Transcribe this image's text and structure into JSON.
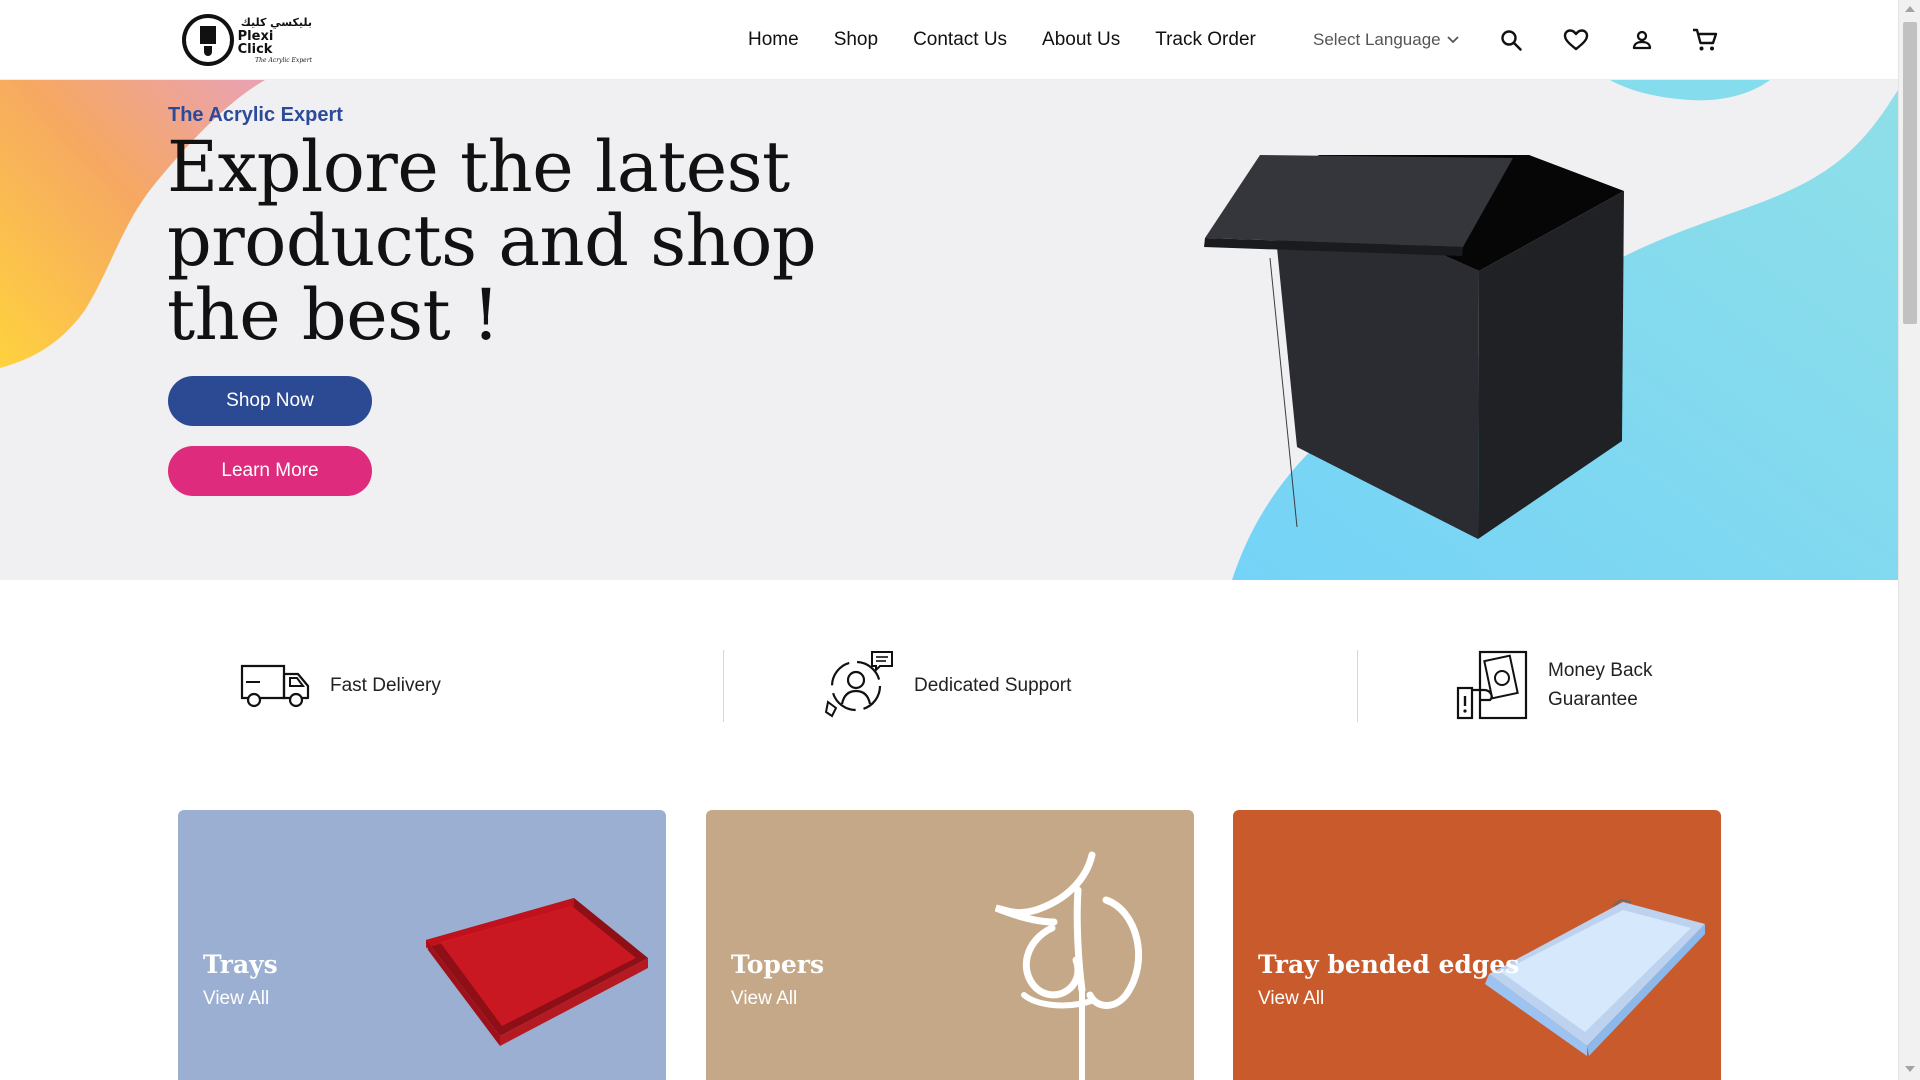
{
  "brand": {
    "arabic_name": "بليكسي كليك",
    "name": "Plexi Click",
    "tagline": "The Acrylic Expert"
  },
  "nav": {
    "items": [
      "Home",
      "Shop",
      "Contact Us",
      "About Us",
      "Track Order"
    ]
  },
  "language": {
    "label": "Select Language"
  },
  "header_icons": [
    "search-icon",
    "heart-icon",
    "user-icon",
    "cart-icon"
  ],
  "hero": {
    "eyebrow": "The Acrylic Expert",
    "title": "Explore the latest products and shop the best !",
    "shop_button": "Shop Now",
    "learn_button": "Learn More"
  },
  "features": [
    {
      "icon": "delivery-truck-icon",
      "label": "Fast Delivery"
    },
    {
      "icon": "support-agent-icon",
      "label": "Dedicated Support"
    },
    {
      "icon": "money-back-icon",
      "label": "Money Back Guarantee"
    }
  ],
  "categories": [
    {
      "title": "Trays",
      "link": "View All",
      "color": "#9aafd1"
    },
    {
      "title": "Topers",
      "link": "View All",
      "color": "#c4a887"
    },
    {
      "title": "Tray bended edges",
      "link": "View All",
      "color": "#c95a2c"
    }
  ],
  "colors": {
    "primary_blue": "#2c4a94",
    "accent_pink": "#de2b7d",
    "hero_bg": "#f0f0f2",
    "blob_cyan": "#7ad7f0",
    "blob_orange": "#f5a45c"
  }
}
